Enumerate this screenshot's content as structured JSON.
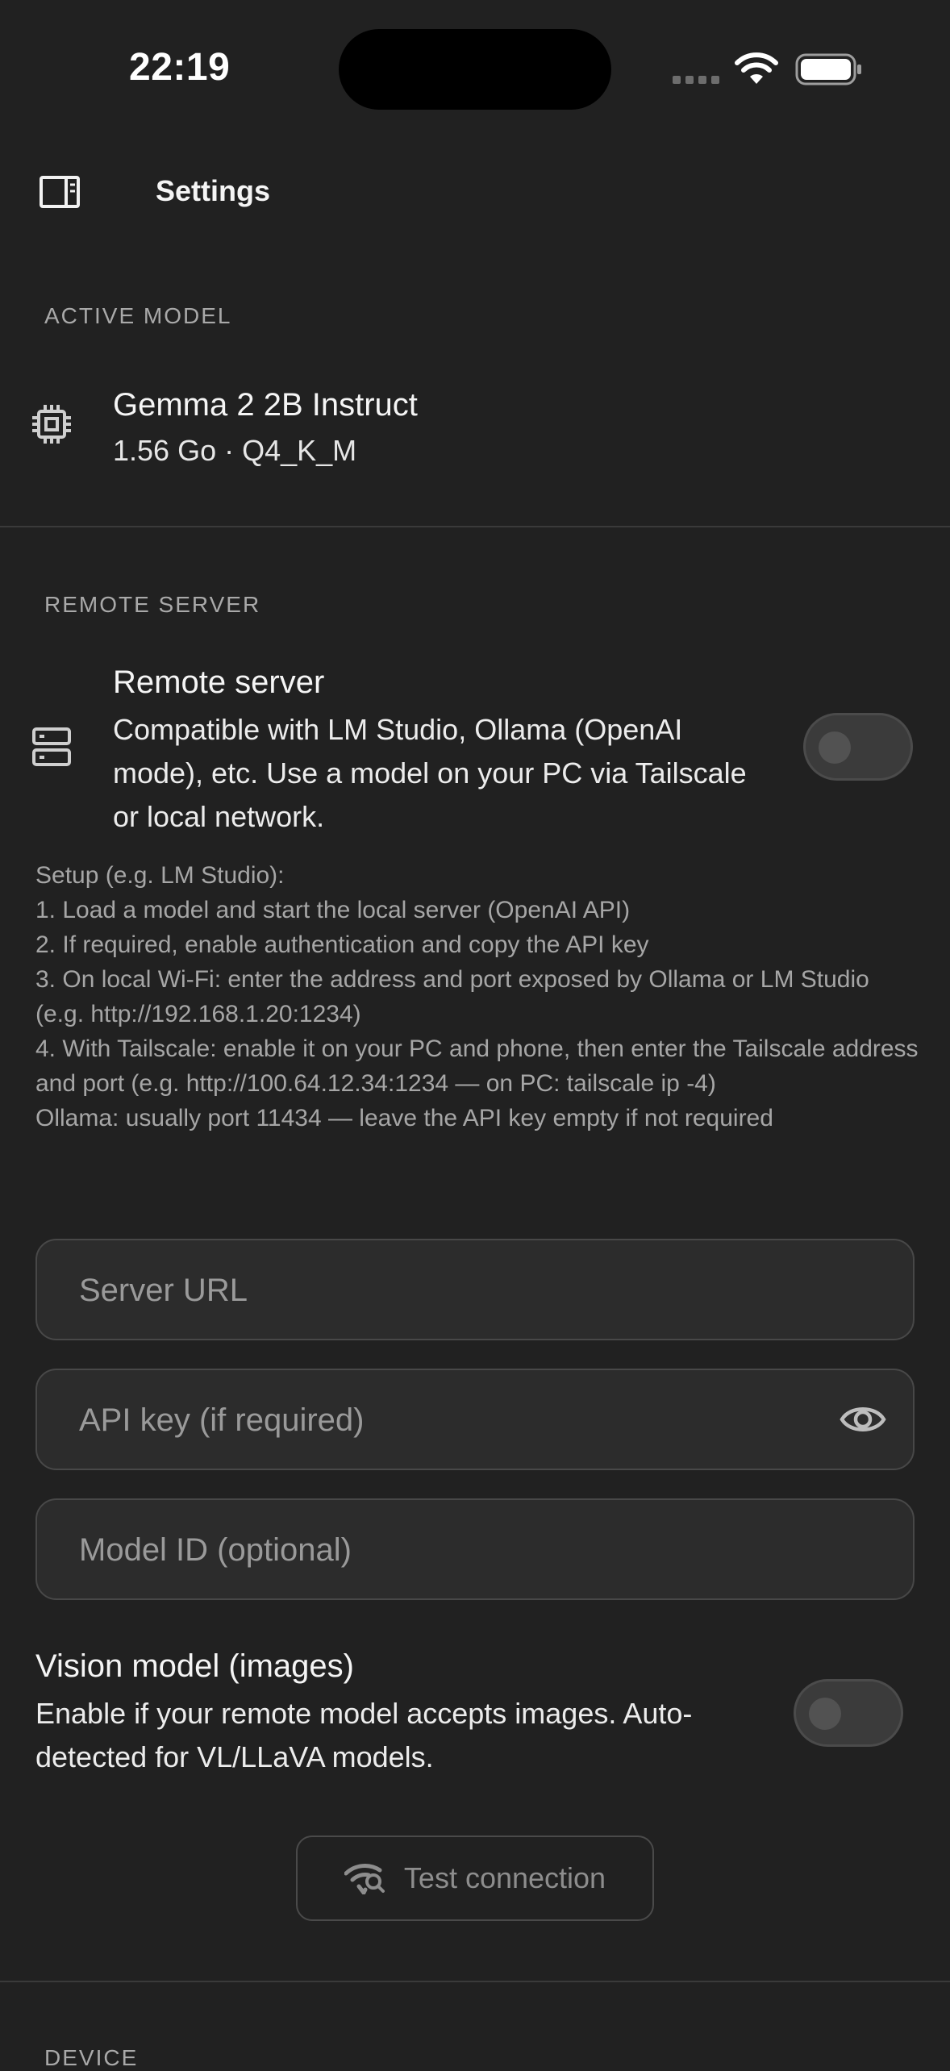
{
  "status_bar": {
    "time": "22:19"
  },
  "header": {
    "title": "Settings"
  },
  "active_model": {
    "section_label": "ACTIVE MODEL",
    "name": "Gemma 2 2B Instruct",
    "meta": "1.56 Go · Q4_K_M"
  },
  "remote_server": {
    "section_label": "REMOTE SERVER",
    "title": "Remote server",
    "description": "Compatible with LM Studio, Ollama (OpenAI mode), etc. Use a model on your PC via Tailscale or local network.",
    "enabled": false,
    "setup_text": "Setup (e.g. LM Studio):\n1. Load a model and start the local server (OpenAI API)\n2. If required, enable authentication and copy the API key\n3. On local Wi-Fi: enter the address and port exposed by Ollama or LM Studio (e.g. http://192.168.1.20:1234)\n4. With Tailscale: enable it on your PC and phone, then enter the Tailscale address and port (e.g. http://100.64.12.34:1234 — on PC: tailscale ip -4)\nOllama: usually port 11434 — leave the API key empty if not required",
    "server_url": {
      "placeholder": "Server URL",
      "value": ""
    },
    "api_key": {
      "placeholder": "API key (if required)",
      "value": ""
    },
    "model_id": {
      "placeholder": "Model ID (optional)",
      "value": ""
    },
    "vision": {
      "title": "Vision model (images)",
      "description": "Enable if your remote model accepts images. Auto-detected for VL/LLaVA models.",
      "enabled": false
    },
    "test_button_label": "Test connection"
  },
  "device": {
    "section_label": "DEVICE"
  },
  "colors": {
    "background": "#212121",
    "field_background": "#2c2c2c",
    "muted_text": "#a6a6a6"
  }
}
